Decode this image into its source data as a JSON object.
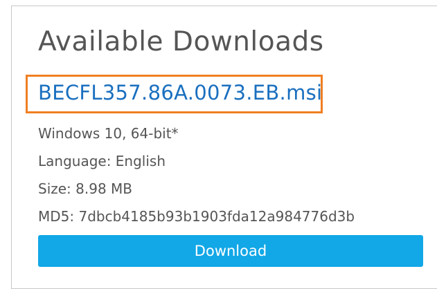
{
  "panel": {
    "title": "Available Downloads",
    "file": {
      "name": "BECFL357.86A.0073.EB.msi"
    },
    "details": {
      "os": "Windows 10, 64-bit*",
      "language": "Language: English",
      "size": "Size: 8.98 MB",
      "md5": "MD5: 7dbcb4185b93b1903fda12a984776d3b"
    },
    "download_label": "Download"
  },
  "colors": {
    "link": "#1a6fbf",
    "highlight": "#f07f22",
    "button": "#12a7e6",
    "text": "#555555"
  }
}
